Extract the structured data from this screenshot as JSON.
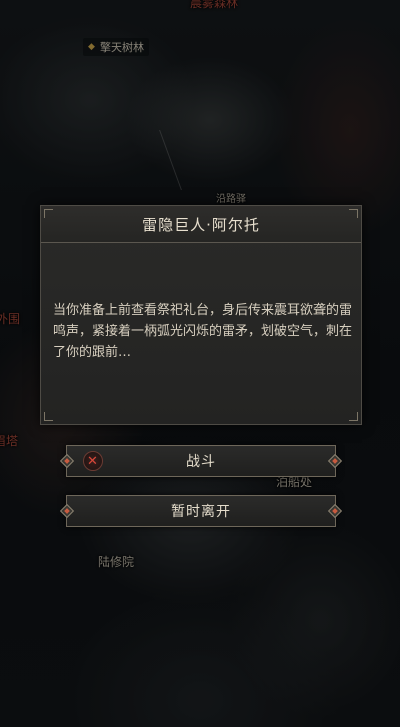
{
  "map": {
    "top_label": "晨雾森林",
    "chip_label": "擎天树林",
    "mid_label": "沿路驿",
    "left_label_1": "外围",
    "left_label_2": "眉塔",
    "right_label": "泊船处",
    "bottom_label": "陆修院"
  },
  "dialog": {
    "title": "雷隐巨人·阿尔托",
    "body": "当你准备上前查看祭祀礼台，身后传来震耳欲聋的雷鸣声，紧接着一柄弧光闪烁的雷矛，划破空气，刺在了你的跟前…"
  },
  "actions": {
    "fight_label": "战斗",
    "fight_icon": "crossed-swords-icon",
    "leave_label": "暂时离开"
  },
  "colors": {
    "accent": "#c75b3f",
    "panel": "#2a2a28",
    "border": "#6e675a"
  }
}
